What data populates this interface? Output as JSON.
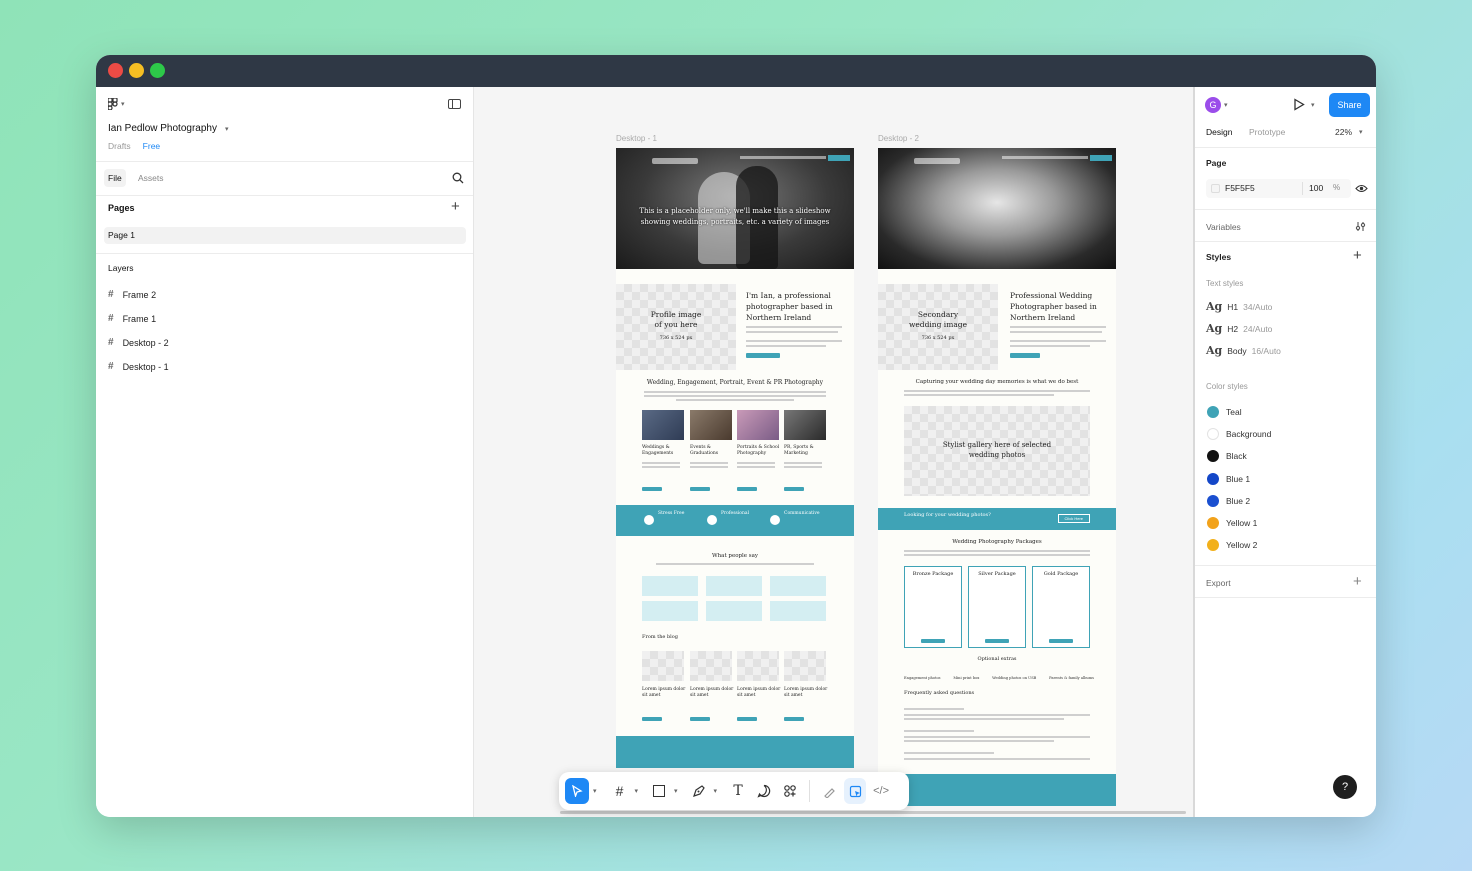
{
  "window": {
    "controls": [
      "close",
      "minimize",
      "maximize"
    ],
    "colors": {
      "close": "#ec4b45",
      "minimize": "#f5be23",
      "maximize": "#2dc849",
      "titlebar": "#2f3845"
    }
  },
  "left_panel": {
    "file_name": "Ian Pedlow Photography",
    "location": "Drafts",
    "plan": "Free",
    "tabs": [
      "File",
      "Assets"
    ],
    "pages_title": "Pages",
    "pages": [
      "Page 1"
    ],
    "layers_title": "Layers",
    "layers": [
      "Frame 2",
      "Frame 1",
      "Desktop - 2",
      "Desktop - 1"
    ]
  },
  "canvas": {
    "frame1_label": "Desktop - 1",
    "frame2_label": "Desktop - 2",
    "frame1": {
      "hero_text": "This is a placeholder only, we'll make this a slideshow showing weddings, portraits, etc. a variety of images",
      "profile_placeholder": "Profile image of you here",
      "profile_size": "736 x 524 px",
      "intro_heading": "I'm Ian, a professional photographer based in Northern Ireland",
      "services_heading": "Wedding, Engagement, Portrait, Event & PR Photography",
      "services": [
        "Weddings & Engagements",
        "Events & Graduations",
        "Portraits & School Photography",
        "PR, Sports & Marketing"
      ],
      "features": [
        "Stress Free",
        "Professional",
        "Communicative"
      ],
      "testimonials_heading": "What people say",
      "blog_heading": "From the blog",
      "blog_posts": [
        "Lorem ipsum dolor sit amet",
        "Lorem ipsum dolor sit amet",
        "Lorem ipsum dolor sit amet",
        "Lorem ipsum dolor sit amet"
      ]
    },
    "frame2": {
      "secondary_placeholder": "Secondary wedding image",
      "secondary_size": "736 x 524 px",
      "intro_heading": "Professional Wedding Photographer based in Northern Ireland",
      "capture_heading": "Capturing your wedding day memories is what we do best",
      "gallery_placeholder": "Stylist gallery here of selected wedding photos",
      "cta_banner": "Looking for your wedding photos?",
      "cta_button": "Click Here",
      "packages_heading": "Wedding Photography Packages",
      "packages": [
        "Bronze Package",
        "Silver Package",
        "Gold Package"
      ],
      "extras_heading": "Optional extras",
      "extras": [
        "Engagement photos",
        "Mini print box",
        "Wedding photos on USB",
        "Parents & family albums"
      ],
      "faq_heading": "Frequently asked questions"
    }
  },
  "toolbar": {
    "tools": [
      "move-tool",
      "frame-tool",
      "rectangle-tool",
      "pen-tool",
      "text-tool",
      "comment-tool",
      "actions-tool",
      "draw-mode",
      "design-mode",
      "dev-mode"
    ]
  },
  "right_panel": {
    "avatar_initial": "G",
    "share_label": "Share",
    "tabs": [
      "Design",
      "Prototype"
    ],
    "zoom": "22%",
    "page_section": "Page",
    "page_color": "F5F5F5",
    "page_opacity": "100",
    "page_opacity_unit": "%",
    "variables_label": "Variables",
    "styles_label": "Styles",
    "text_styles_label": "Text styles",
    "text_styles": [
      {
        "sample": "Ag",
        "name": "H1",
        "spec": "34/Auto"
      },
      {
        "sample": "Ag",
        "name": "H2",
        "spec": "24/Auto"
      },
      {
        "sample": "Ag",
        "name": "Body",
        "spec": "16/Auto"
      }
    ],
    "color_styles_label": "Color styles",
    "color_styles": [
      {
        "name": "Teal",
        "color": "#3fa3b6"
      },
      {
        "name": "Background",
        "color": "#ffffff"
      },
      {
        "name": "Black",
        "color": "#111111"
      },
      {
        "name": "Blue 1",
        "color": "#1447c8"
      },
      {
        "name": "Blue 2",
        "color": "#1a4fd0"
      },
      {
        "name": "Yellow 1",
        "color": "#f2a21b"
      },
      {
        "name": "Yellow 2",
        "color": "#f2b01b"
      }
    ],
    "export_label": "Export",
    "help_label": "?",
    "accent_color": "#1e88f5"
  }
}
